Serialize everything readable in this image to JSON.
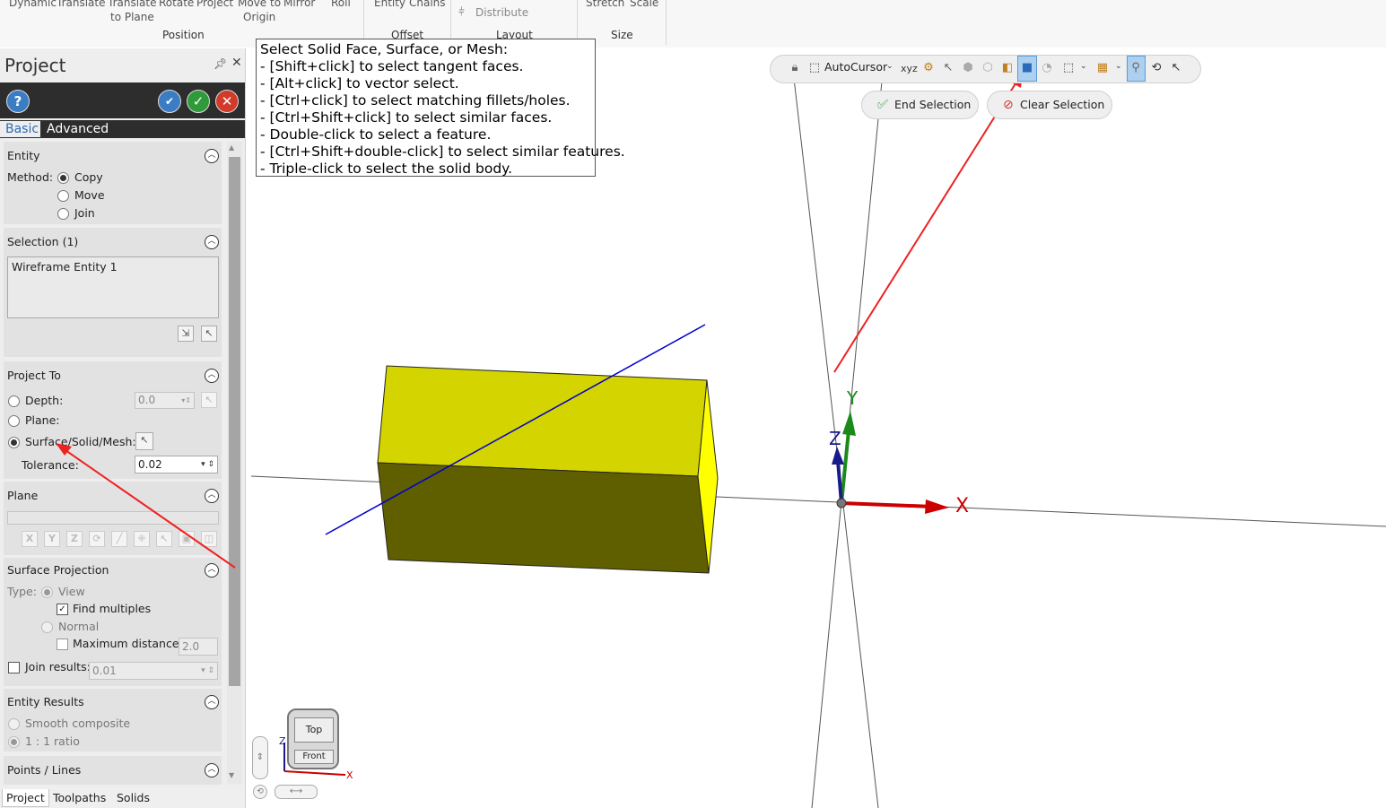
{
  "ribbon": {
    "row1": [
      "Dynamic",
      "Translate",
      "Translate",
      "Rotate",
      "Project",
      "Move to",
      "Mirror",
      "Roll",
      "Entity",
      "Chains",
      "Distribute",
      "Stretch",
      "Scale"
    ],
    "row2": [
      "to Plane",
      "Origin"
    ],
    "groups": [
      "Position",
      "Offset",
      "Layout",
      "Size"
    ]
  },
  "panel": {
    "title": "Project",
    "pin_icon": "pin-icon",
    "close_icon": "close-icon",
    "tabs": [
      "Basic",
      "Advanced"
    ],
    "entity": {
      "title": "Entity",
      "method_label": "Method:",
      "options": [
        "Copy",
        "Move",
        "Join"
      ],
      "selected": "Copy"
    },
    "selection": {
      "title": "Selection (1)",
      "items": [
        "Wireframe Entity 1"
      ]
    },
    "project_to": {
      "title": "Project To",
      "depth_label": "Depth:",
      "depth_value": "0.0",
      "plane_label": "Plane:",
      "surface_label": "Surface/Solid/Mesh:",
      "selected": "Surface/Solid/Mesh:",
      "tolerance_label": "Tolerance:",
      "tolerance_value": "0.02"
    },
    "plane": {
      "title": "Plane",
      "buttons": [
        "X",
        "Y",
        "Z"
      ]
    },
    "surface_projection": {
      "title": "Surface Projection",
      "type_label": "Type:",
      "view_label": "View",
      "find_multiples_label": "Find multiples",
      "find_multiples_checked": true,
      "normal_label": "Normal",
      "max_distance_label": "Maximum distance:",
      "max_distance_value": "2.0",
      "join_results_label": "Join results:",
      "join_results_value": "0.01"
    },
    "entity_results": {
      "title": "Entity Results",
      "smooth_label": "Smooth composite",
      "ratio_label": "1 : 1 ratio"
    },
    "points_lines": {
      "title": "Points / Lines"
    },
    "bottom_tabs": [
      "Project",
      "Toolpaths",
      "Solids"
    ]
  },
  "tooltip": {
    "lines": [
      "Select Solid Face, Surface, or Mesh:",
      "- [Shift+click] to select tangent faces.",
      "- [Alt+click] to vector select.",
      "- [Ctrl+click] to select matching fillets/holes.",
      "- [Ctrl+Shift+click] to select similar faces.",
      "- Double-click to select a feature.",
      "- [Ctrl+Shift+double-click] to select similar features.",
      "- Triple-click to select the solid body."
    ]
  },
  "selection_toolbar": {
    "autocursor_label": "AutoCursor",
    "xyz_label": "xyz",
    "end_selection_label": "End Selection",
    "clear_selection_label": "Clear Selection"
  },
  "viewport": {
    "axis_labels": {
      "x": "X",
      "y": "Y",
      "z": "Z"
    },
    "viewcube": {
      "top": "Top",
      "front": "Front",
      "z": "Z",
      "x": "X"
    }
  },
  "colors": {
    "box_top": "#d4d400",
    "box_front": "#5f5f00",
    "box_side": "#ffff00",
    "x_axis": "#cc0000",
    "y_axis": "#1a8a1a",
    "z_axis": "#1a1a8c",
    "wire_line": "#0000cc",
    "annotation_arrow": "#ee2222",
    "highlight_button": "#aed0f0"
  }
}
